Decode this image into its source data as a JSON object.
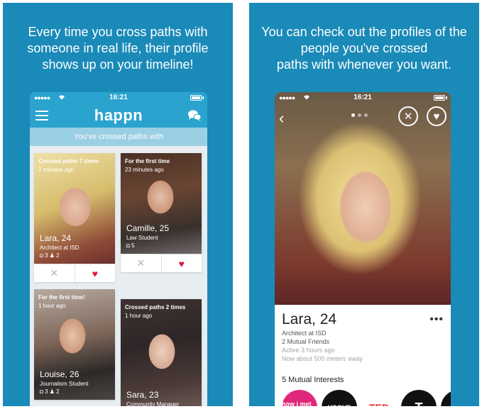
{
  "left_panel": {
    "caption_lines": [
      "Every time you cross paths with",
      "someone in real life, their profile",
      "shows up on your timeline!"
    ],
    "status_time": "16:21",
    "logo": "happn",
    "banner": "You've crossed paths with",
    "cards": [
      {
        "top_line1": "Crossed paths 7 times",
        "top_line2": "2 minutes ago",
        "name": "Lara, 24",
        "job": "Architect at ISD",
        "photos": "3",
        "friends": "2"
      },
      {
        "top_line1": "For the first time",
        "top_line2": "23 minutes ago",
        "name": "Camille, 25",
        "job": "Law Student",
        "photos": "5",
        "friends": ""
      },
      {
        "top_line1": "For the first time!",
        "top_line2": "1 hour ago",
        "name": "Louise, 26",
        "job": "Journalism Student",
        "photos": "3",
        "friends": "2"
      },
      {
        "top_line1": "Crossed paths 2 times",
        "top_line2": "1 hour ago",
        "name": "Sara, 23",
        "job": "Community Manager",
        "photos": "",
        "friends": ""
      }
    ]
  },
  "right_panel": {
    "caption_lines": [
      "You can check out the profiles of the",
      "people you've crossed",
      "paths with whenever you want."
    ],
    "status_time": "16:21",
    "profile": {
      "name": "Lara,",
      "age": "24",
      "job": "Architect at ISD",
      "mutual_friends": "2 Mutual Friends",
      "active": "Active 3 hours ago",
      "distance": "Now about 500 meters away",
      "more": "•••"
    },
    "interests_title": "5 Mutual Interests",
    "interests": [
      {
        "label": "how i met your",
        "color": "#e0287a"
      },
      {
        "label": "VOGUE",
        "color": "#111111"
      },
      {
        "label": "TED",
        "color": "#e62b1e"
      },
      {
        "label": "T",
        "color": "#111111"
      },
      {
        "label": "",
        "color": "#111111"
      }
    ]
  },
  "colors": {
    "panel_bg": "#1a8ab8",
    "app_blue": "#2aa3cf",
    "heart": "#e01840"
  }
}
